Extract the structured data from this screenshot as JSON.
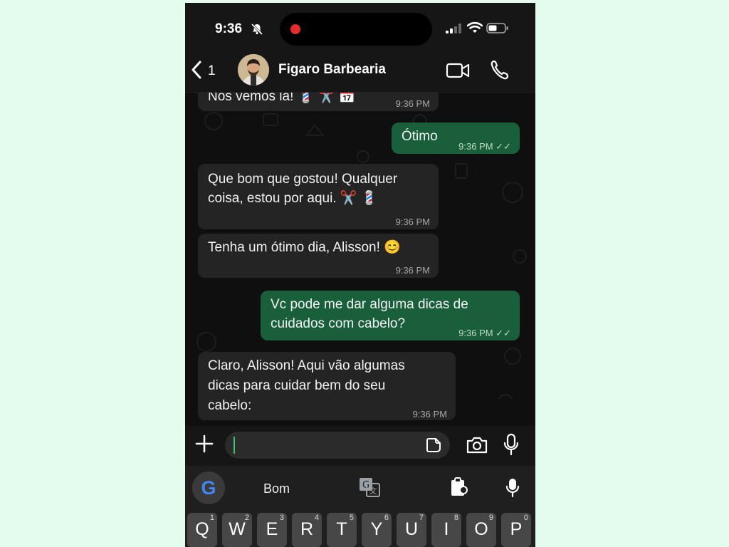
{
  "status": {
    "time": "9:36"
  },
  "header": {
    "back_count": "1",
    "contact_name": "Figaro Barbearia"
  },
  "messages": [
    {
      "dir": "in",
      "text": "Nos vemos lá! 💈 ✂️ 📅",
      "time": "9:36 PM"
    },
    {
      "dir": "out",
      "text": "Ótimo",
      "time": "9:36 PM"
    },
    {
      "dir": "in",
      "line1": "Que bom que gostou! Qualquer",
      "line2": "coisa, estou por aqui. ✂️ 💈",
      "time": "9:36 PM"
    },
    {
      "dir": "in",
      "text": "Tenha um ótimo dia, Alisson! 😊",
      "time": "9:36 PM"
    },
    {
      "dir": "out",
      "line1": "Vc pode me dar alguma dicas de",
      "line2": "cuidados com cabelo?",
      "time": "9:36 PM"
    },
    {
      "dir": "in",
      "line1": "Claro, Alisson! Aqui vão algumas",
      "line2": "dicas para cuidar bem do seu",
      "line3": "cabelo:",
      "time": "9:36 PM"
    }
  ],
  "keyboard": {
    "suggestion": "Bom",
    "keys": [
      {
        "l": "Q",
        "n": "1"
      },
      {
        "l": "W",
        "n": "2"
      },
      {
        "l": "E",
        "n": "3"
      },
      {
        "l": "R",
        "n": "4"
      },
      {
        "l": "T",
        "n": "5"
      },
      {
        "l": "Y",
        "n": "6"
      },
      {
        "l": "U",
        "n": "7"
      },
      {
        "l": "I",
        "n": "8"
      },
      {
        "l": "O",
        "n": "9"
      },
      {
        "l": "P",
        "n": "0"
      }
    ]
  },
  "colors": {
    "background": "#e4fced",
    "outgoing_bubble": "#1a5f3c",
    "incoming_bubble": "#242424",
    "recording_dot": "#e52d2d"
  },
  "icons": [
    "bell-slash-icon",
    "signal-icon",
    "wifi-icon",
    "battery-icon",
    "back-chevron-icon",
    "video-call-icon",
    "phone-icon",
    "plus-icon",
    "sticker-icon",
    "camera-icon",
    "microphone-icon",
    "google-icon",
    "translate-icon",
    "clipboard-icon"
  ]
}
